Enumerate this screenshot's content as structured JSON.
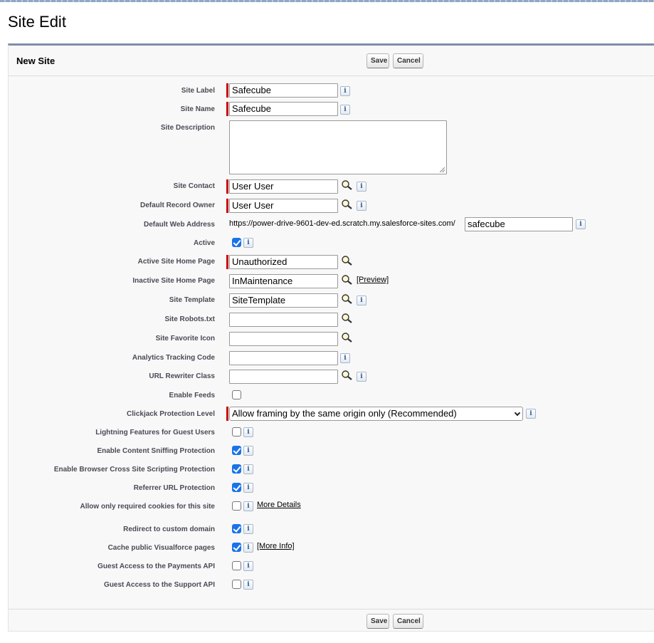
{
  "page": {
    "title": "Site Edit"
  },
  "block": {
    "title": "New Site",
    "save_label": "Save",
    "cancel_label": "Cancel"
  },
  "fields": {
    "site_label": {
      "label": "Site Label",
      "value": "Safecube"
    },
    "site_name": {
      "label": "Site Name",
      "value": "Safecube"
    },
    "site_description": {
      "label": "Site Description",
      "value": ""
    },
    "site_contact": {
      "label": "Site Contact",
      "value": "User User"
    },
    "default_record_owner": {
      "label": "Default Record Owner",
      "value": "User User"
    },
    "default_web_address": {
      "label": "Default Web Address",
      "prefix": "https://power-drive-9601-dev-ed.scratch.my.salesforce-sites.com/",
      "value": "safecube"
    },
    "active": {
      "label": "Active",
      "checked": true
    },
    "active_site_home_page": {
      "label": "Active Site Home Page",
      "value": "Unauthorized"
    },
    "inactive_site_home_page": {
      "label": "Inactive Site Home Page",
      "value": "InMaintenance",
      "link": "[Preview]"
    },
    "site_template": {
      "label": "Site Template",
      "value": "SiteTemplate"
    },
    "site_robots": {
      "label": "Site Robots.txt",
      "value": ""
    },
    "site_favorite_icon": {
      "label": "Site Favorite Icon",
      "value": ""
    },
    "analytics_tracking_code": {
      "label": "Analytics Tracking Code",
      "value": ""
    },
    "url_rewriter_class": {
      "label": "URL Rewriter Class",
      "value": ""
    },
    "enable_feeds": {
      "label": "Enable Feeds",
      "checked": false
    },
    "clickjack_protection": {
      "label": "Clickjack Protection Level",
      "value": "Allow framing by the same origin only (Recommended)"
    },
    "lightning_features": {
      "label": "Lightning Features for Guest Users",
      "checked": false
    },
    "content_sniffing": {
      "label": "Enable Content Sniffing Protection",
      "checked": true
    },
    "browser_xss": {
      "label": "Enable Browser Cross Site Scripting Protection",
      "checked": true
    },
    "referrer_url": {
      "label": "Referrer URL Protection",
      "checked": true
    },
    "required_cookies": {
      "label": "Allow only required cookies for this site",
      "checked": false,
      "link": "More Details"
    },
    "redirect_custom_domain": {
      "label": "Redirect to custom domain",
      "checked": true
    },
    "cache_visualforce": {
      "label": "Cache public Visualforce pages",
      "checked": true,
      "link": "[More Info]"
    },
    "guest_payments_api": {
      "label": "Guest Access to the Payments API",
      "checked": false
    },
    "guest_support_api": {
      "label": "Guest Access to the Support API",
      "checked": false
    }
  },
  "icons": {
    "info": "info-icon",
    "lookup": "lookup-magnifier-icon"
  },
  "colors": {
    "required": "#cc0000",
    "block_border": "#7d8fa9",
    "checkbox_on": "#1a73e8",
    "info_text": "#2a5a97"
  }
}
